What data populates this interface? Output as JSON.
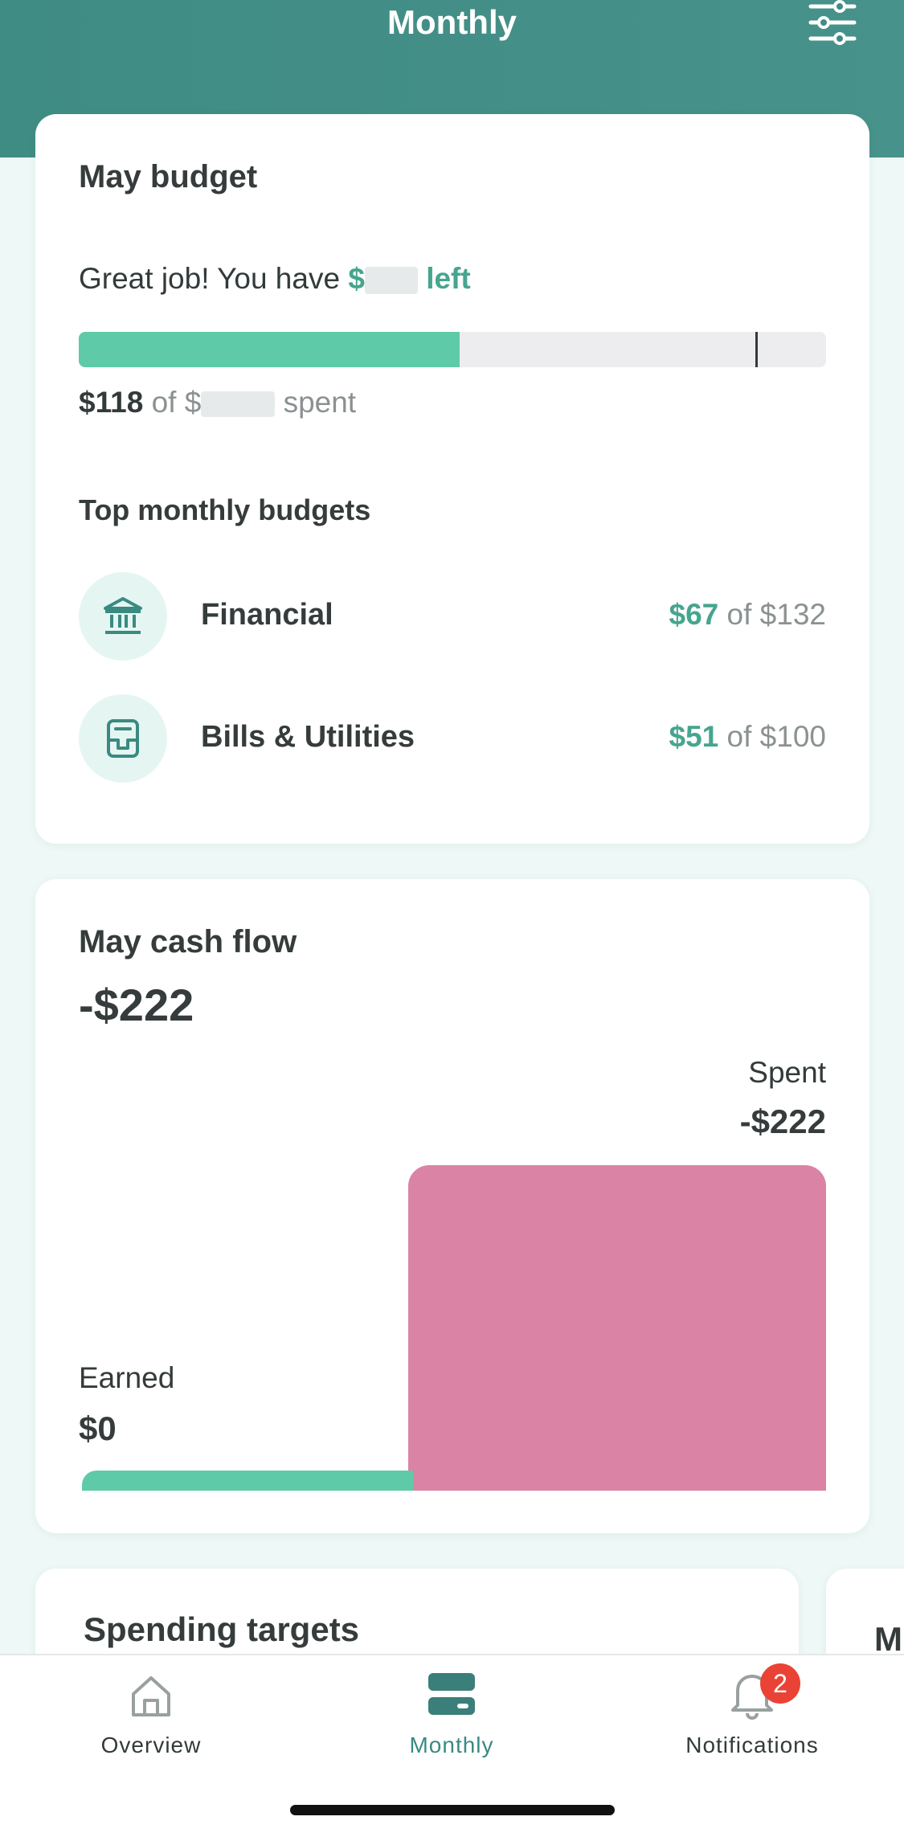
{
  "header": {
    "title": "Monthly",
    "filter_icon": "sliders-icon"
  },
  "budget": {
    "title": "May budget",
    "message_prefix": "Great job! You have",
    "message_currency": "$",
    "message_suffix": "left",
    "progress_fraction": 0.51,
    "marker_fraction": 0.905,
    "spent_amount": "$118",
    "spent_of": "of $",
    "spent_suffix": "spent",
    "top_title": "Top monthly budgets",
    "categories": [
      {
        "name": "Financial",
        "icon": "bank-icon",
        "spent": "$67",
        "of": "of $132"
      },
      {
        "name": "Bills & Utilities",
        "icon": "bills-icon",
        "spent": "$51",
        "of": "of $100"
      }
    ]
  },
  "cashflow": {
    "title": "May cash flow",
    "total": "-$222",
    "spent_label": "Spent",
    "spent_value": "-$222",
    "earned_label": "Earned",
    "earned_value": "$0"
  },
  "spending_targets": {
    "title": "Spending targets",
    "next_card_initial": "M"
  },
  "tabs": [
    {
      "label": "Overview",
      "icon": "home-icon",
      "active": false
    },
    {
      "label": "Monthly",
      "icon": "monthly-icon",
      "active": true
    },
    {
      "label": "Notifications",
      "icon": "bell-icon",
      "active": false,
      "badge": "2"
    }
  ],
  "colors": {
    "accent": "#46a58f",
    "header": "#42908a",
    "spent_bar": "#db83a4",
    "earned_bar": "#5ecaa8",
    "badge": "#ea4335"
  }
}
